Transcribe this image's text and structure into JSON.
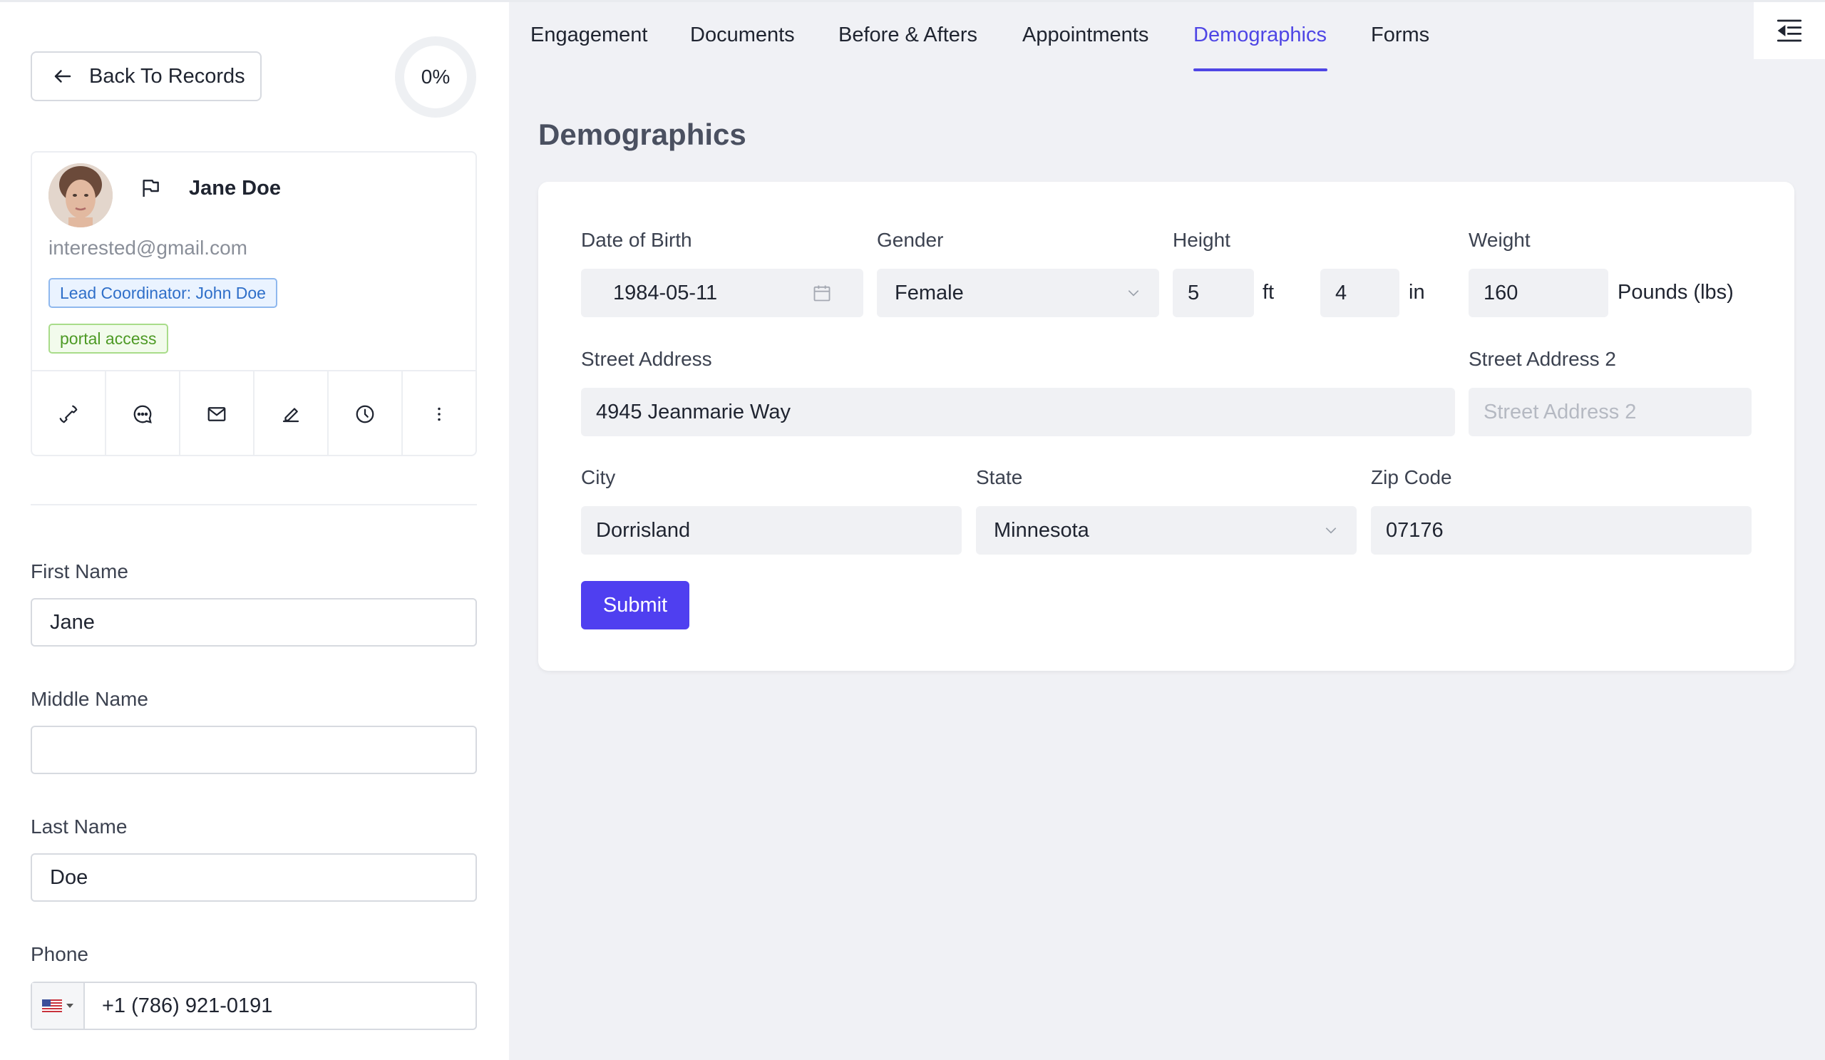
{
  "back_button": {
    "label": "Back To Records"
  },
  "progress": {
    "label": "0%",
    "value": 0
  },
  "profile": {
    "name": "Jane Doe",
    "email": "interested@gmail.com",
    "coordinator_tag": "Lead Coordinator: John Doe",
    "portal_tag": "portal access",
    "actions": [
      "phone-icon",
      "chat-icon",
      "mail-icon",
      "edit-icon",
      "clock-icon",
      "more-vertical-icon"
    ]
  },
  "left_form": {
    "first_name": {
      "label": "First Name",
      "value": "Jane"
    },
    "middle_name": {
      "label": "Middle Name",
      "value": ""
    },
    "last_name": {
      "label": "Last Name",
      "value": "Doe"
    },
    "phone": {
      "label": "Phone",
      "value": "+1 (786) 921-0191",
      "country": "us-flag-icon"
    }
  },
  "tabs": [
    {
      "label": "Engagement",
      "active": false
    },
    {
      "label": "Documents",
      "active": false
    },
    {
      "label": "Before & Afters",
      "active": false
    },
    {
      "label": "Appointments",
      "active": false
    },
    {
      "label": "Demographics",
      "active": true
    },
    {
      "label": "Forms",
      "active": false
    }
  ],
  "page_title": "Demographics",
  "demographics": {
    "dob": {
      "label": "Date of Birth",
      "value": "1984-05-11"
    },
    "gender": {
      "label": "Gender",
      "value": "Female"
    },
    "height": {
      "label": "Height",
      "feet": "5",
      "feet_unit": "ft",
      "inches": "4",
      "inches_unit": "in"
    },
    "weight": {
      "label": "Weight",
      "value": "160",
      "unit": "Pounds (lbs)"
    },
    "street": {
      "label": "Street Address",
      "value": "4945 Jeanmarie Way"
    },
    "street2": {
      "label": "Street Address 2",
      "placeholder": "Street Address 2",
      "value": ""
    },
    "city": {
      "label": "City",
      "value": "Dorrisland"
    },
    "state": {
      "label": "State",
      "value": "Minnesota"
    },
    "zip": {
      "label": "Zip Code",
      "value": "07176"
    },
    "submit_label": "Submit"
  },
  "colors": {
    "accent": "#4f46e5",
    "submit": "#4f3ff0",
    "panel_bg": "#f0f1f5"
  }
}
